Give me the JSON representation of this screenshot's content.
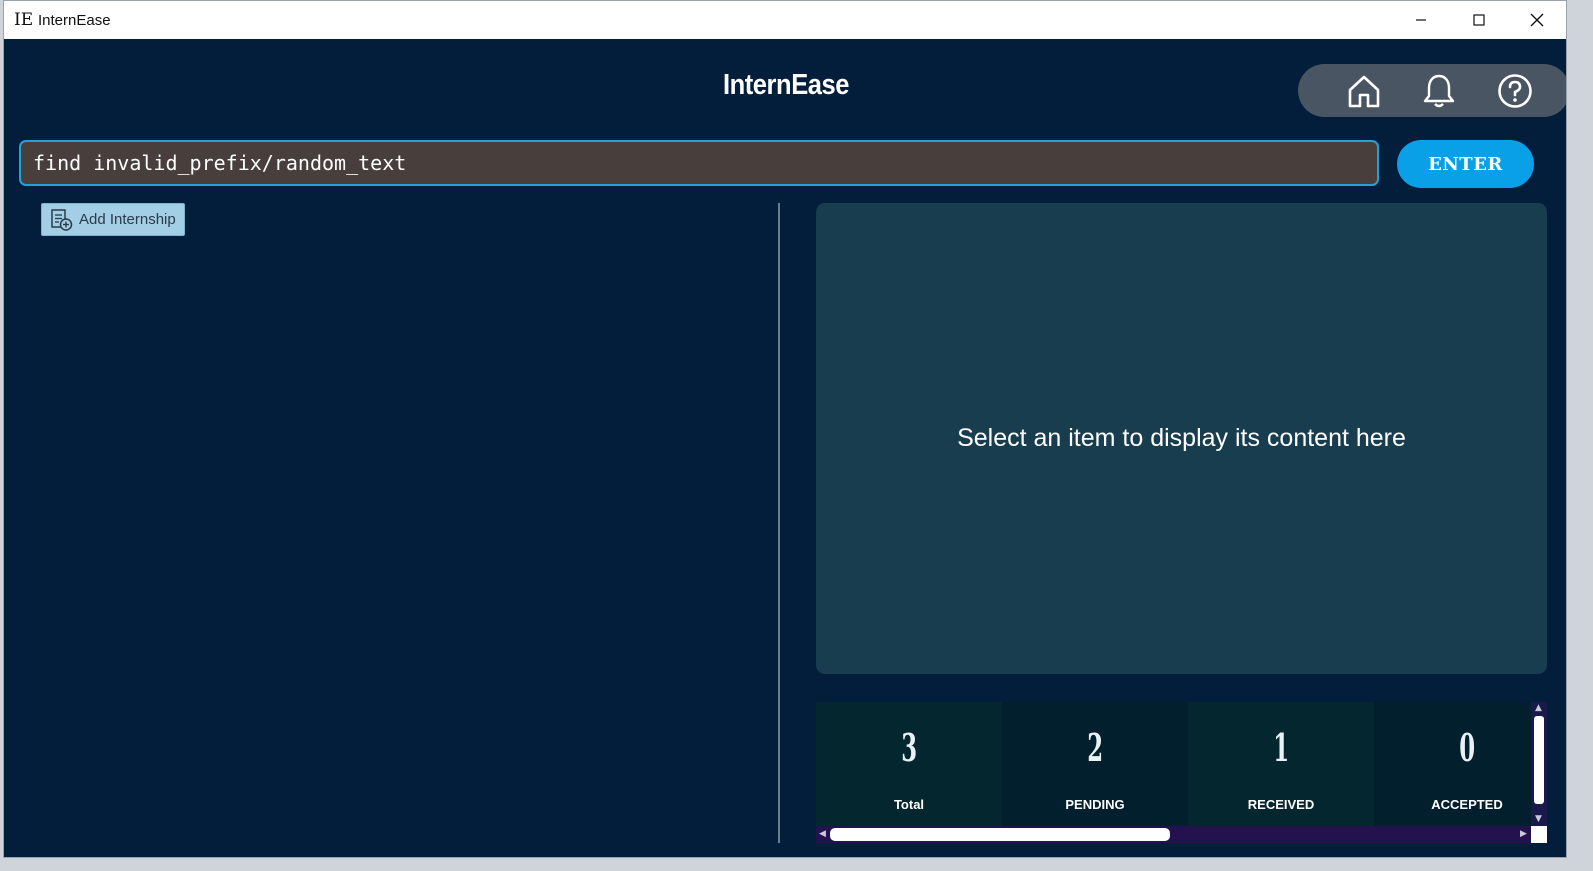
{
  "window": {
    "app_icon_text": "IE",
    "title": "InternEase"
  },
  "header": {
    "title": "InternEase"
  },
  "nav": {
    "icons": [
      "home-icon",
      "bell-icon",
      "help-icon"
    ]
  },
  "command": {
    "value": "find invalid_prefix/random_text",
    "enter_label": "ENTER"
  },
  "list": {
    "add_label": "Add Internship"
  },
  "detail": {
    "placeholder": "Select an item to display its content here"
  },
  "stats": [
    {
      "value": "3",
      "label": "Total"
    },
    {
      "value": "2",
      "label": "PENDING"
    },
    {
      "value": "1",
      "label": "RECEIVED"
    },
    {
      "value": "0",
      "label": "ACCEPTED"
    }
  ],
  "colors": {
    "background": "#021e3b",
    "accent": "#0aa0e8",
    "input_bg": "#483e3b",
    "detail_bg": "#173d4f"
  }
}
